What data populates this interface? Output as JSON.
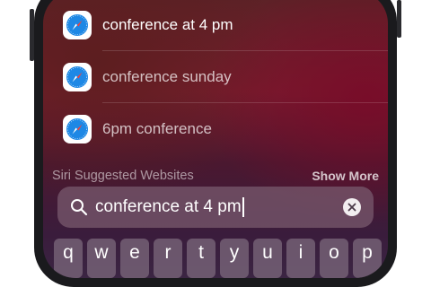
{
  "suggestions": [
    {
      "label": "conference at 4 pm",
      "icon": "safari-icon",
      "dim": false
    },
    {
      "label": "conference sunday",
      "icon": "safari-icon",
      "dim": true
    },
    {
      "label": "6pm conference",
      "icon": "safari-icon",
      "dim": true
    }
  ],
  "section": {
    "title": "Siri Suggested Websites",
    "more": "Show More"
  },
  "search": {
    "query": "conference at 4 pm",
    "icon": "magnifying-glass-icon",
    "clear_icon": "clear-x-icon"
  },
  "keyboard": {
    "row1": [
      "q",
      "w",
      "e",
      "r",
      "t",
      "y",
      "u",
      "i",
      "o",
      "p"
    ]
  },
  "colors": {
    "accent_blue": "#1e88e5",
    "text": "#ffffff"
  }
}
